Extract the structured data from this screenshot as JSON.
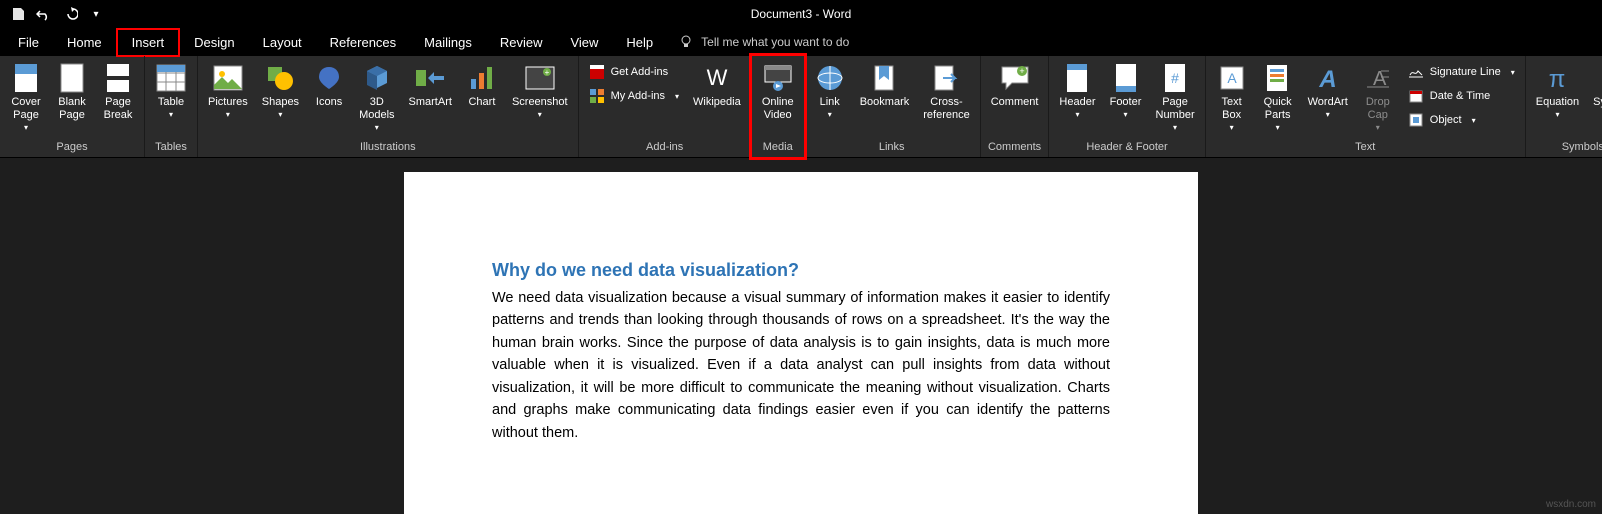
{
  "title": "Document3 - Word",
  "qat": {
    "save": "Save",
    "undo": "Undo",
    "redo": "Redo",
    "customize": "Customize"
  },
  "tabs": {
    "file": "File",
    "home": "Home",
    "insert": "Insert",
    "design": "Design",
    "layout": "Layout",
    "references": "References",
    "mailings": "Mailings",
    "review": "Review",
    "view": "View",
    "help": "Help"
  },
  "tellme": "Tell me what you want to do",
  "groups": {
    "pages": {
      "label": "Pages",
      "cover": "Cover\nPage",
      "blank": "Blank\nPage",
      "break": "Page\nBreak"
    },
    "tables": {
      "label": "Tables",
      "table": "Table"
    },
    "illus": {
      "label": "Illustrations",
      "pictures": "Pictures",
      "shapes": "Shapes",
      "icons": "Icons",
      "models": "3D\nModels",
      "smartart": "SmartArt",
      "chart": "Chart",
      "screenshot": "Screenshot"
    },
    "addins": {
      "label": "Add-ins",
      "get": "Get Add-ins",
      "my": "My Add-ins",
      "wiki": "Wikipedia"
    },
    "media": {
      "label": "Media",
      "video": "Online\nVideo"
    },
    "links": {
      "label": "Links",
      "link": "Link",
      "bookmark": "Bookmark",
      "cross": "Cross-\nreference"
    },
    "comments": {
      "label": "Comments",
      "comment": "Comment"
    },
    "hf": {
      "label": "Header & Footer",
      "header": "Header",
      "footer": "Footer",
      "number": "Page\nNumber"
    },
    "text": {
      "label": "Text",
      "textbox": "Text\nBox",
      "quick": "Quick\nParts",
      "wordart": "WordArt",
      "dropcap": "Drop\nCap",
      "sig": "Signature Line",
      "date": "Date & Time",
      "obj": "Object"
    },
    "symbols": {
      "label": "Symbols",
      "eq": "Equation",
      "sym": "Symbol"
    }
  },
  "doc": {
    "heading": "Why do we need data visualization?",
    "body": "We need data visualization because a visual summary of information makes it easier to identify patterns and trends than looking through thousands of rows on a spreadsheet. It's the way the human brain works. Since the purpose of data analysis is to gain insights, data is much more valuable when it is visualized. Even if a data analyst can pull insights from data without visualization, it will be more difficult to communicate the meaning without visualization. Charts and graphs make communicating data findings easier even if you can identify the patterns without them."
  },
  "watermark": "wsxdn.com"
}
